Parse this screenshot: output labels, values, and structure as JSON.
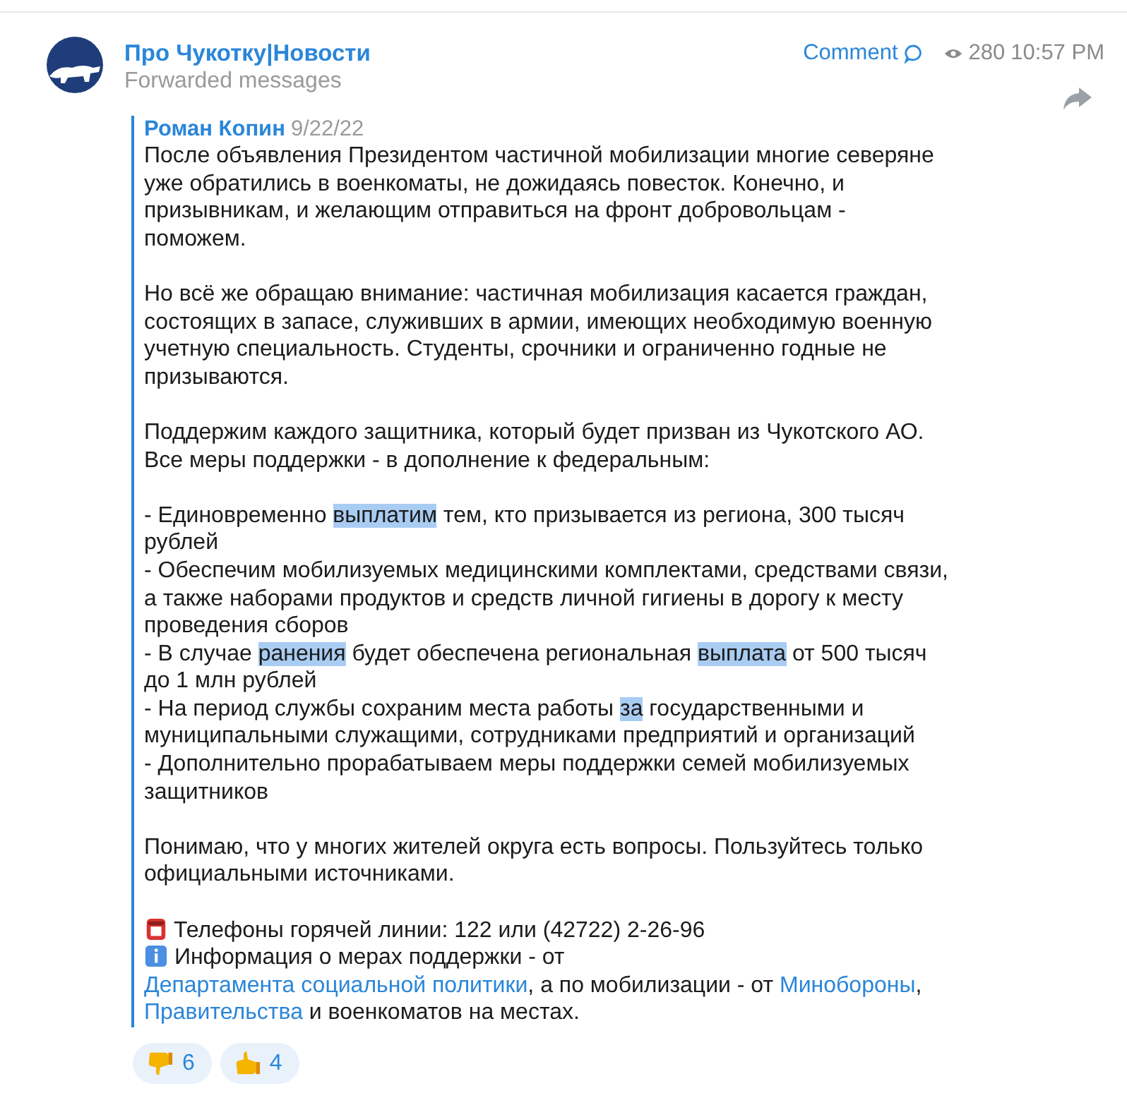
{
  "channel": {
    "name": "Про Чукотку|Новости",
    "subtitle": "Forwarded messages"
  },
  "meta": {
    "comment": "Comment",
    "views": "280",
    "time": "10:57 PM"
  },
  "forward": {
    "author": "Роман Копин",
    "date": "9/22/22"
  },
  "paragraphs": [
    {
      "lines": [
        [
          {
            "kind": "text",
            "text": "После объявления Президентом частичной мобилизации многие северяне уже обратились в военкоматы, не дожидаясь повесток. Конечно, и призывникам, и желающим отправиться на фронт добровольцам - поможем."
          }
        ]
      ]
    },
    {
      "lines": [
        [
          {
            "kind": "text",
            "text": "Но всё же обращаю внимание: частичная мобилизация касается граждан, состоящих в запасе, служивших в армии, имеющих необходимую военную учетную специальность. Студенты, срочники и ограниченно годные не призываются."
          }
        ]
      ]
    },
    {
      "lines": [
        [
          {
            "kind": "text",
            "text": "Поддержим каждого защитника, который будет призван из Чукотского АО. Все меры поддержки - в дополнение к федеральным:"
          }
        ]
      ]
    },
    {
      "lines": [
        [
          {
            "kind": "text",
            "text": "- Единовременно "
          },
          {
            "kind": "highlight",
            "text": "выплатим"
          },
          {
            "kind": "text",
            "text": " тем, кто призывается из региона, 300 тысяч рублей"
          }
        ],
        [
          {
            "kind": "text",
            "text": "- Обеспечим мобилизуемых медицинскими комплектами, средствами связи, а также наборами продуктов и средств личной гигиены в дорогу к месту проведения сборов"
          }
        ],
        [
          {
            "kind": "text",
            "text": "- В случае "
          },
          {
            "kind": "highlight",
            "text": "ранения"
          },
          {
            "kind": "text",
            "text": " будет обеспечена региональная "
          },
          {
            "kind": "highlight",
            "text": "выплата"
          },
          {
            "kind": "text",
            "text": " от 500 тысяч до 1 млн рублей"
          }
        ],
        [
          {
            "kind": "text",
            "text": "- На период службы сохраним места работы "
          },
          {
            "kind": "highlight",
            "text": "за"
          },
          {
            "kind": "text",
            "text": " государственными и муниципальными служащими, сотрудниками предприятий и организаций"
          }
        ],
        [
          {
            "kind": "text",
            "text": "- Дополнительно прорабатываем меры поддержки семей мобилизуемых защитников"
          }
        ]
      ]
    },
    {
      "lines": [
        [
          {
            "kind": "text",
            "text": "Понимаю, что у многих жителей округа есть вопросы. Пользуйтесь только официальными источниками."
          }
        ]
      ]
    }
  ],
  "hotline": "Телефоны горячей линии: 122 или (42722) 2-26-96",
  "info": [
    {
      "kind": "text",
      "text": "Информация о мерах поддержки - от "
    },
    {
      "kind": "link",
      "text": "Департамента социальной политики"
    },
    {
      "kind": "text",
      "text": ", а по мобилизации - от "
    },
    {
      "kind": "link",
      "text": "Минобороны"
    },
    {
      "kind": "text",
      "text": ", "
    },
    {
      "kind": "link",
      "text": "Правительства"
    },
    {
      "kind": "text",
      "text": " и военкоматов на местах."
    }
  ],
  "reactions": [
    {
      "kind": "dislike",
      "count": "6"
    },
    {
      "kind": "like",
      "count": "4"
    }
  ]
}
